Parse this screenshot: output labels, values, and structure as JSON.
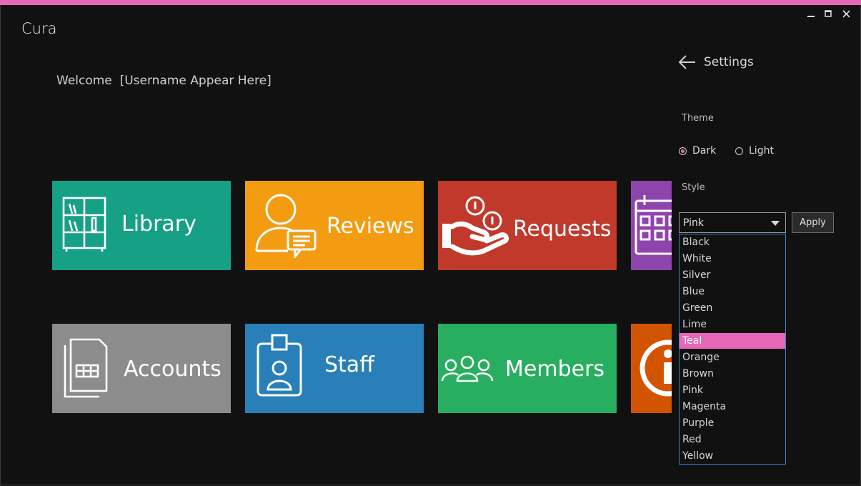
{
  "app": {
    "title": "Cura"
  },
  "colors": {
    "accent": "#e868b8",
    "background": "#111111"
  },
  "window_controls": [
    {
      "name": "minimize",
      "glyph": "—"
    },
    {
      "name": "maximize",
      "glyph": "☐"
    },
    {
      "name": "close",
      "glyph": "✕"
    }
  ],
  "welcome": {
    "prefix": "Welcome",
    "username": "[Username Appear Here]"
  },
  "tiles": [
    {
      "label": "Library",
      "icon": "bookshelf-icon",
      "color": "#16a085"
    },
    {
      "label": "Reviews",
      "icon": "user-comment-icon",
      "color": "#f39c12"
    },
    {
      "label": "Requests",
      "icon": "hand-coins-icon",
      "color": "#c0392b"
    },
    {
      "label": "",
      "icon": "calendar-icon",
      "color": "#8e44ad"
    },
    {
      "label": "Accounts",
      "icon": "spreadsheet-document-icon",
      "color": "#8c8c8c"
    },
    {
      "label": "Staff",
      "icon": "id-badge-icon",
      "color": "#2980b9"
    },
    {
      "label": "Members",
      "icon": "group-icon",
      "color": "#27ae60"
    },
    {
      "label": "",
      "icon": "info-icon",
      "color": "#d35400"
    }
  ],
  "settings": {
    "title": "Settings",
    "theme_label": "Theme",
    "theme_options": [
      {
        "label": "Dark",
        "selected": true
      },
      {
        "label": "Light",
        "selected": false
      }
    ],
    "style_label": "Style",
    "style_selected": "Pink",
    "apply_label": "Apply",
    "style_options": [
      "Black",
      "White",
      "Silver",
      "Blue",
      "Green",
      "Lime",
      "Teal",
      "Orange",
      "Brown",
      "Pink",
      "Magenta",
      "Purple",
      "Red",
      "Yellow"
    ],
    "highlighted_option": "Teal"
  }
}
